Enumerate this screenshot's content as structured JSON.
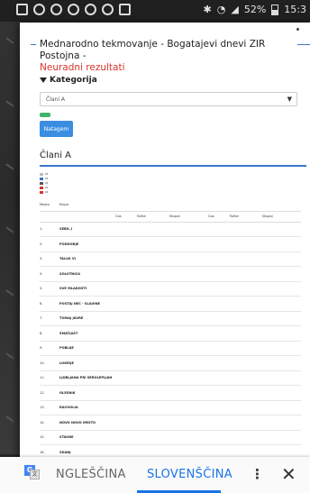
{
  "status_bar": {
    "battery": "52%",
    "time": "15:3"
  },
  "page": {
    "title": "Mednarodno tekmovanje - Bogatajevi dnevi ZIR Postojna -",
    "subtitle": "Neuradni rezultati",
    "filter_label": "Kategorija",
    "category_select": "Člani A",
    "section_title": "Člani A",
    "submit_button": "Natagem",
    "table": {
      "headers": [
        "Mesto",
        "Ekipa",
        "",
        "",
        "",
        "",
        "",
        "",
        "",
        ""
      ],
      "subheaders": [
        "Čas",
        "Točke",
        "Skupaj",
        "Čas",
        "Točke",
        "Skupaj"
      ],
      "rows": [
        [
          "1.",
          "SEBIL J"
        ],
        [
          "2.",
          "PODGORJE"
        ],
        [
          "3.",
          "TALUS VI"
        ],
        [
          "4.",
          "SOLOTNICA"
        ],
        [
          "5.",
          "SVE MLADOSTI"
        ],
        [
          "6.",
          "POSTAJ NEC - SLAVINE"
        ],
        [
          "7.",
          "TOMAJ JAVRE"
        ],
        [
          "8.",
          "ŠMATJAŠT"
        ],
        [
          "9.",
          "POBLIJE"
        ],
        [
          "10.",
          "LOKRIJE"
        ],
        [
          "11.",
          "LJUBLJANA PRI SEROLEPLJAH"
        ],
        [
          "12.",
          "OLESNIK"
        ],
        [
          "13.",
          "RACHOLIA"
        ],
        [
          "14.",
          "NOVO NOVO MESTO"
        ],
        [
          "15.",
          "STAVNE"
        ],
        [
          "16.",
          "ŠKANJ"
        ]
      ]
    }
  },
  "translate_bar": {
    "source_lang": "NGLEŠČINA",
    "target_lang": "SLOVENŠČINA",
    "more_icon": "⋮",
    "close_icon": "✕"
  }
}
